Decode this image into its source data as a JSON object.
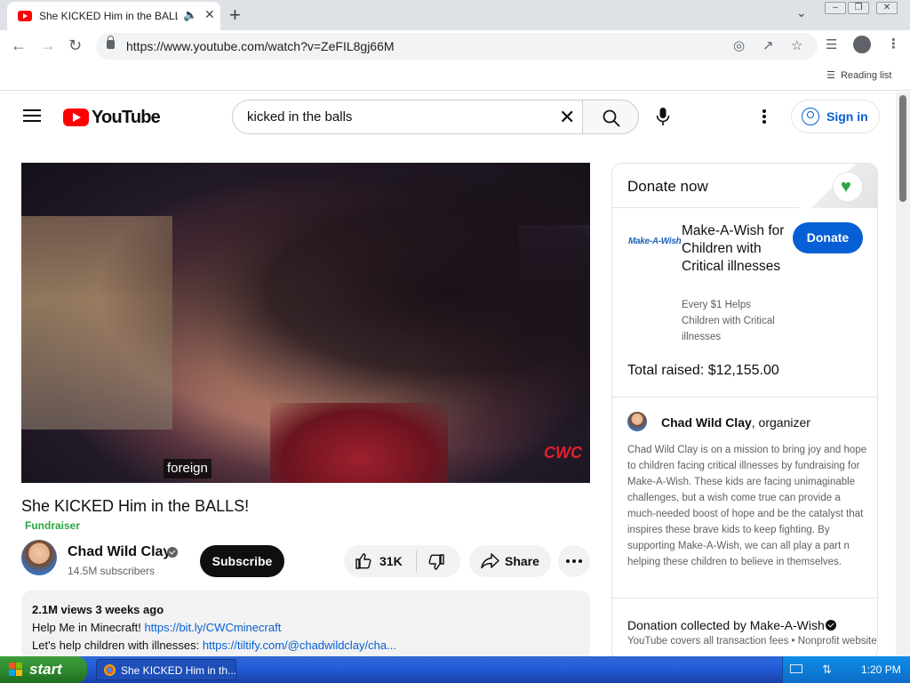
{
  "browser": {
    "tab_title": "She KICKED Him in the BALLS!",
    "url": "https://www.youtube.com/watch?v=ZeFIL8gj66M",
    "reading_list": "Reading list"
  },
  "youtube": {
    "logo_text": "YouTube",
    "search_query": "kicked in the balls",
    "sign_in": "Sign in"
  },
  "video": {
    "caption": "foreign",
    "watermark": "CWC",
    "title": "She KICKED Him in the BALLS!",
    "fundraiser_tag": "Fundraiser",
    "channel_name": "Chad Wild Clay",
    "subscribers": "14.5M subscribers",
    "subscribe_label": "Subscribe",
    "like_count": "31K",
    "share_label": "Share",
    "description": {
      "meta": "2.1M views  3 weeks ago",
      "line1_prefix": "Help Me in Minecraft! ",
      "line1_link": "https://bit.ly/CWCminecraft",
      "line2_prefix": "Let's help children with illnesses: ",
      "line2_link": "https://tiltify.com/@chadwildclay/cha..."
    }
  },
  "donate": {
    "title": "Donate now",
    "charity_logo": "Make-A-Wish",
    "charity_name": "Make-A-Wish for Children with Critical illnesses",
    "charity_tagline": "Every $1 Helps Children with Critical illnesses",
    "donate_label": "Donate",
    "total_raised": "Total raised: $12,155.00",
    "organizer_name": "Chad Wild Clay",
    "organizer_suffix": ", organizer",
    "organizer_text": "Chad Wild Clay is on a mission to bring joy and hope to children facing critical illnesses by fundraising for Make-A-Wish. These kids are facing unimaginable challenges, but a wish come true can provide a much-needed boost of hope and be the catalyst that inspires these brave kids to keep fighting. By supporting Make-A-Wish, we can all play a part n helping these children to believe in themselves.",
    "collected_by": "Donation collected by Make-A-Wish",
    "fees_note": "YouTube covers all transaction fees  •  Nonprofit website"
  },
  "taskbar": {
    "start_label": "start",
    "task_label": "She KICKED Him in th...",
    "clock": "1:20 PM"
  },
  "colors": {
    "youtube_red": "#ff0000",
    "link_blue": "#065fd4",
    "fundraiser_green": "#2ba640",
    "xp_blue": "#245edb",
    "xp_start_green": "#2f8a2f"
  }
}
